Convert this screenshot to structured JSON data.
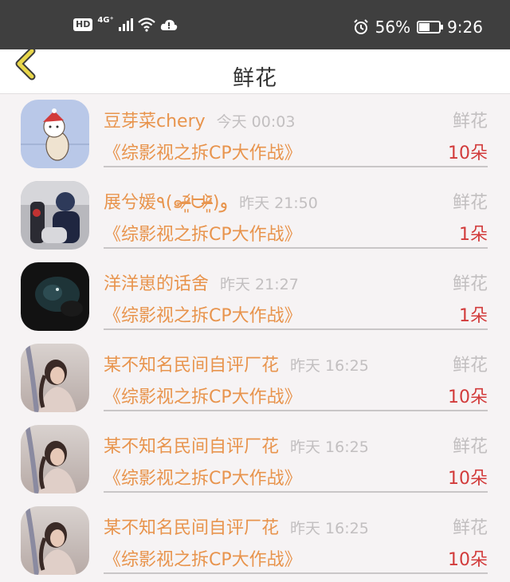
{
  "status_bar": {
    "hd": "HD",
    "network": "4G⁺",
    "battery_percent": "56%",
    "battery_level": 0.56,
    "time": "9:26"
  },
  "header": {
    "title": "鲜花",
    "back_icon": "chevron-left-icon"
  },
  "colors": {
    "name": "#e8944d",
    "count": "#d23b3b",
    "muted": "#c2bfc0",
    "back": "#e8d64a"
  },
  "records": [
    {
      "name": "豆芽菜chery",
      "time": "今天 00:03",
      "gift": "鲜花",
      "work": "《综影视之拆CP大作战》",
      "count": "10朵"
    },
    {
      "name": "展兮媛٩(๑ᵒ̴̶̷͈᷄ᗨᵒ̴̶̷͈᷅)و",
      "time": "昨天 21:50",
      "gift": "鲜花",
      "work": "《综影视之拆CP大作战》",
      "count": "1朵"
    },
    {
      "name": "洋洋崽的话舍",
      "time": "昨天 21:27",
      "gift": "鲜花",
      "work": "《综影视之拆CP大作战》",
      "count": "1朵"
    },
    {
      "name": "某不知名民间自评厂花",
      "time": "昨天 16:25",
      "gift": "鲜花",
      "work": "《综影视之拆CP大作战》",
      "count": "10朵"
    },
    {
      "name": "某不知名民间自评厂花",
      "time": "昨天 16:25",
      "gift": "鲜花",
      "work": "《综影视之拆CP大作战》",
      "count": "10朵"
    },
    {
      "name": "某不知名民间自评厂花",
      "time": "昨天 16:25",
      "gift": "鲜花",
      "work": "《综影视之拆CP大作战》",
      "count": "10朵"
    }
  ]
}
